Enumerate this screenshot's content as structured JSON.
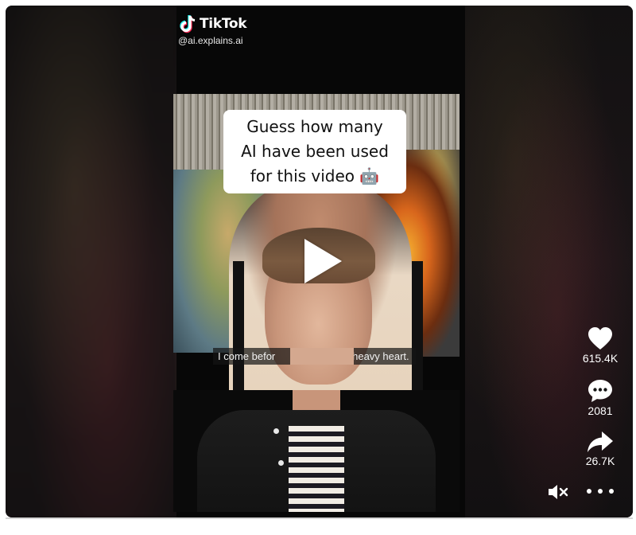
{
  "brand": {
    "logo_icon": "tiktok-icon",
    "name": "TikTok",
    "handle": "@ai.explains.ai"
  },
  "video": {
    "caption_line1": "Guess how many",
    "caption_line2": "AI have been used",
    "caption_line3": "for this video 🤖",
    "subtitle_left": "I come befor",
    "subtitle_right": "a heavy heart.",
    "play_icon": "play-icon"
  },
  "actions": {
    "like": {
      "icon": "heart-icon",
      "count": "615.4K"
    },
    "comment": {
      "icon": "comment-icon",
      "count": "2081"
    },
    "share": {
      "icon": "share-icon",
      "count": "26.7K"
    }
  },
  "controls": {
    "mute_icon": "speaker-muted-icon",
    "more_icon": "more-icon"
  },
  "colors": {
    "background": "#111111",
    "text": "#ffffff",
    "caption_bg": "#ffffff"
  }
}
